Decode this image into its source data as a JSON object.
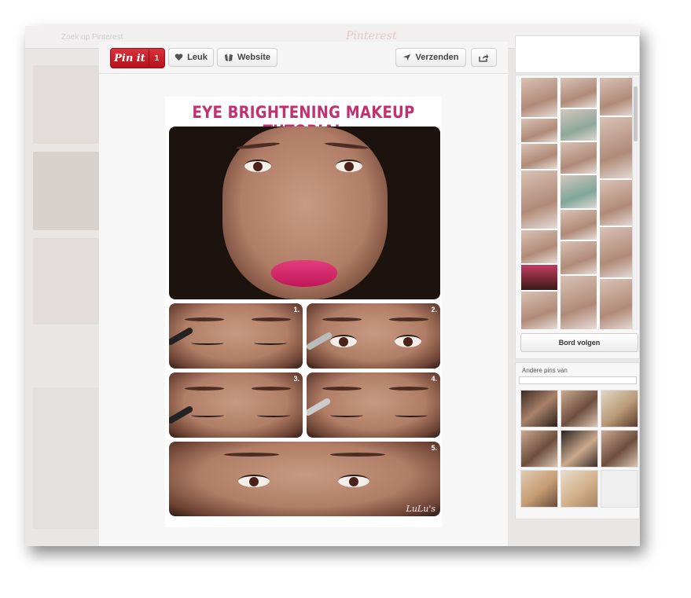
{
  "background": {
    "brand": "Pinterest",
    "search_hint": "Zoek op Pinterest"
  },
  "toolbar": {
    "pinit_label": "Pin it",
    "pinit_count": "1",
    "like_label": "Leuk",
    "website_label": "Website",
    "send_label": "Verzenden"
  },
  "pin_image": {
    "title": "EYE BRIGHTENING MAKEUP TUTORIAL",
    "steps": [
      "1.",
      "2.",
      "3.",
      "4.",
      "5."
    ],
    "watermark": "LuLu's",
    "title_color": "#c2306f",
    "lip_color": "#e23e7a"
  },
  "board": {
    "follow_label": "Bord volgen"
  },
  "other_pins": {
    "title": "Andere pins van"
  },
  "colors": {
    "pinit_red": "#cb2027",
    "panel_bg": "#f7f7f7"
  },
  "icons": [
    "heart-icon",
    "website-icon",
    "send-icon",
    "share-icon"
  ]
}
